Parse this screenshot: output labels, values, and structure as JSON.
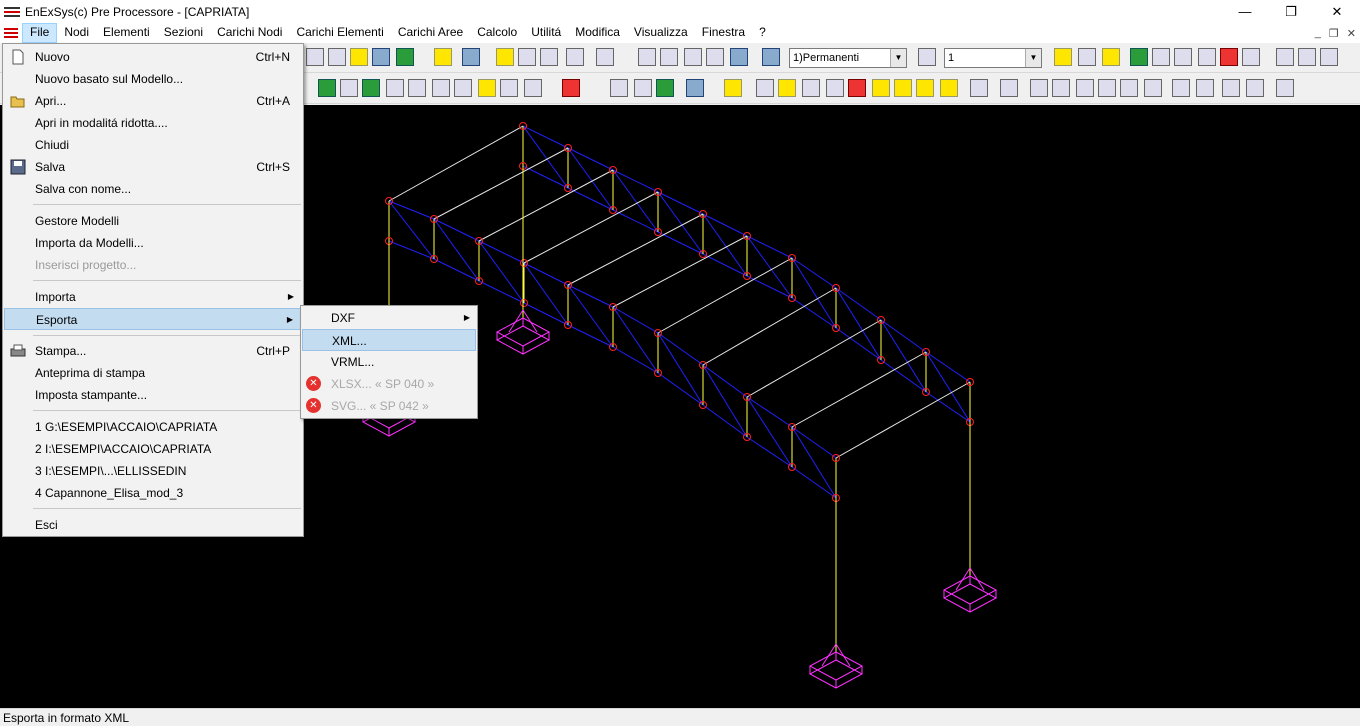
{
  "window": {
    "title": "EnExSys(c) Pre Processore - [CAPRIATA]",
    "controls": [
      "—",
      "❐",
      "✕"
    ]
  },
  "menubar": {
    "items": [
      "File",
      "Nodi",
      "Elementi",
      "Sezioni",
      "Carichi Nodi",
      "Carichi Elementi",
      "Carichi Aree",
      "Calcolo",
      "Utilitá",
      "Modifica",
      "Visualizza",
      "Finestra",
      "?"
    ],
    "active": "File",
    "mdi_controls": [
      "_",
      "❐",
      "✕"
    ]
  },
  "toolbar": {
    "load_case": "1)Permanenti",
    "step_value": "1"
  },
  "file_menu": {
    "items": [
      {
        "label": "Nuovo",
        "shortcut": "Ctrl+N",
        "icon": "new-file-icon"
      },
      {
        "label": "Nuovo basato sul Modello...",
        "shortcut": ""
      },
      {
        "label": "Apri...",
        "shortcut": "Ctrl+A",
        "icon": "open-folder-icon"
      },
      {
        "label": "Apri in modalitá ridotta....",
        "shortcut": ""
      },
      {
        "label": "Chiudi",
        "shortcut": ""
      },
      {
        "label": "Salva",
        "shortcut": "Ctrl+S",
        "icon": "save-disk-icon"
      },
      {
        "label": "Salva con nome...",
        "shortcut": ""
      },
      {
        "label": "Gestore Modelli",
        "shortcut": ""
      },
      {
        "label": "Importa da Modelli...",
        "shortcut": ""
      },
      {
        "label": "Inserisci progetto...",
        "shortcut": "",
        "disabled": true
      },
      {
        "label": "Importa",
        "shortcut": "",
        "submenu": true
      },
      {
        "label": "Esporta",
        "shortcut": "",
        "submenu": true,
        "highlighted": true
      },
      {
        "label": "Stampa...",
        "shortcut": "Ctrl+P",
        "icon": "printer-icon"
      },
      {
        "label": "Anteprima di stampa",
        "shortcut": ""
      },
      {
        "label": "Imposta stampante...",
        "shortcut": ""
      },
      {
        "label": "1 G:\\ESEMPI\\ACCAIO\\CAPRIATA",
        "shortcut": ""
      },
      {
        "label": "2 I:\\ESEMPI\\ACCAIO\\CAPRIATA",
        "shortcut": ""
      },
      {
        "label": "3 I:\\ESEMPI\\...\\ELLISSEDIN",
        "shortcut": ""
      },
      {
        "label": "4 Capannone_Elisa_mod_3",
        "shortcut": ""
      },
      {
        "label": "Esci",
        "shortcut": ""
      }
    ]
  },
  "export_submenu": {
    "items": [
      {
        "label": "DXF",
        "submenu": true
      },
      {
        "label": "XML...",
        "highlighted": true
      },
      {
        "label": "VRML..."
      },
      {
        "label": "XLSX... « SP 040 »",
        "disabled": true,
        "icon": "error-icon"
      },
      {
        "label": "SVG... « SP 042 »",
        "disabled": true,
        "icon": "error-icon"
      }
    ]
  },
  "status": {
    "text": "Esporta in formato XML"
  },
  "colors": {
    "canvas_bg": "#000000",
    "beam_blue": "#2020ff",
    "column_yellow": "#ffff40",
    "floor_white": "#e8e8e8",
    "node_red": "#ff2020",
    "support_magenta": "#ff30ff",
    "menu_highlight": "#c3dcf0"
  }
}
